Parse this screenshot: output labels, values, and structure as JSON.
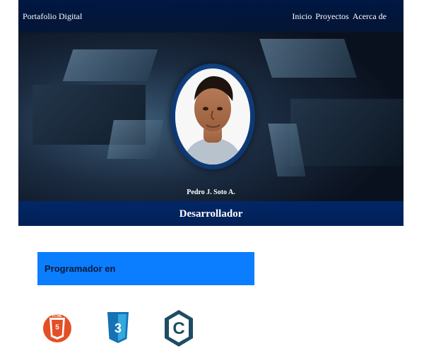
{
  "header": {
    "brand": "Portafolio Digital",
    "nav": [
      "Inicio",
      "Proyectos",
      "Acerca de"
    ]
  },
  "profile": {
    "name": "Pedro J. Soto A.",
    "role": "Desarrollador"
  },
  "skills": {
    "title": "Programador en",
    "icons": [
      "html5-icon",
      "css3-icon",
      "c-language-icon"
    ],
    "html_label": "HTML"
  },
  "colors": {
    "accent": "#0b7dff",
    "html5": "#e34f26",
    "css3": "#1572b6",
    "c": "#1d4d63"
  }
}
